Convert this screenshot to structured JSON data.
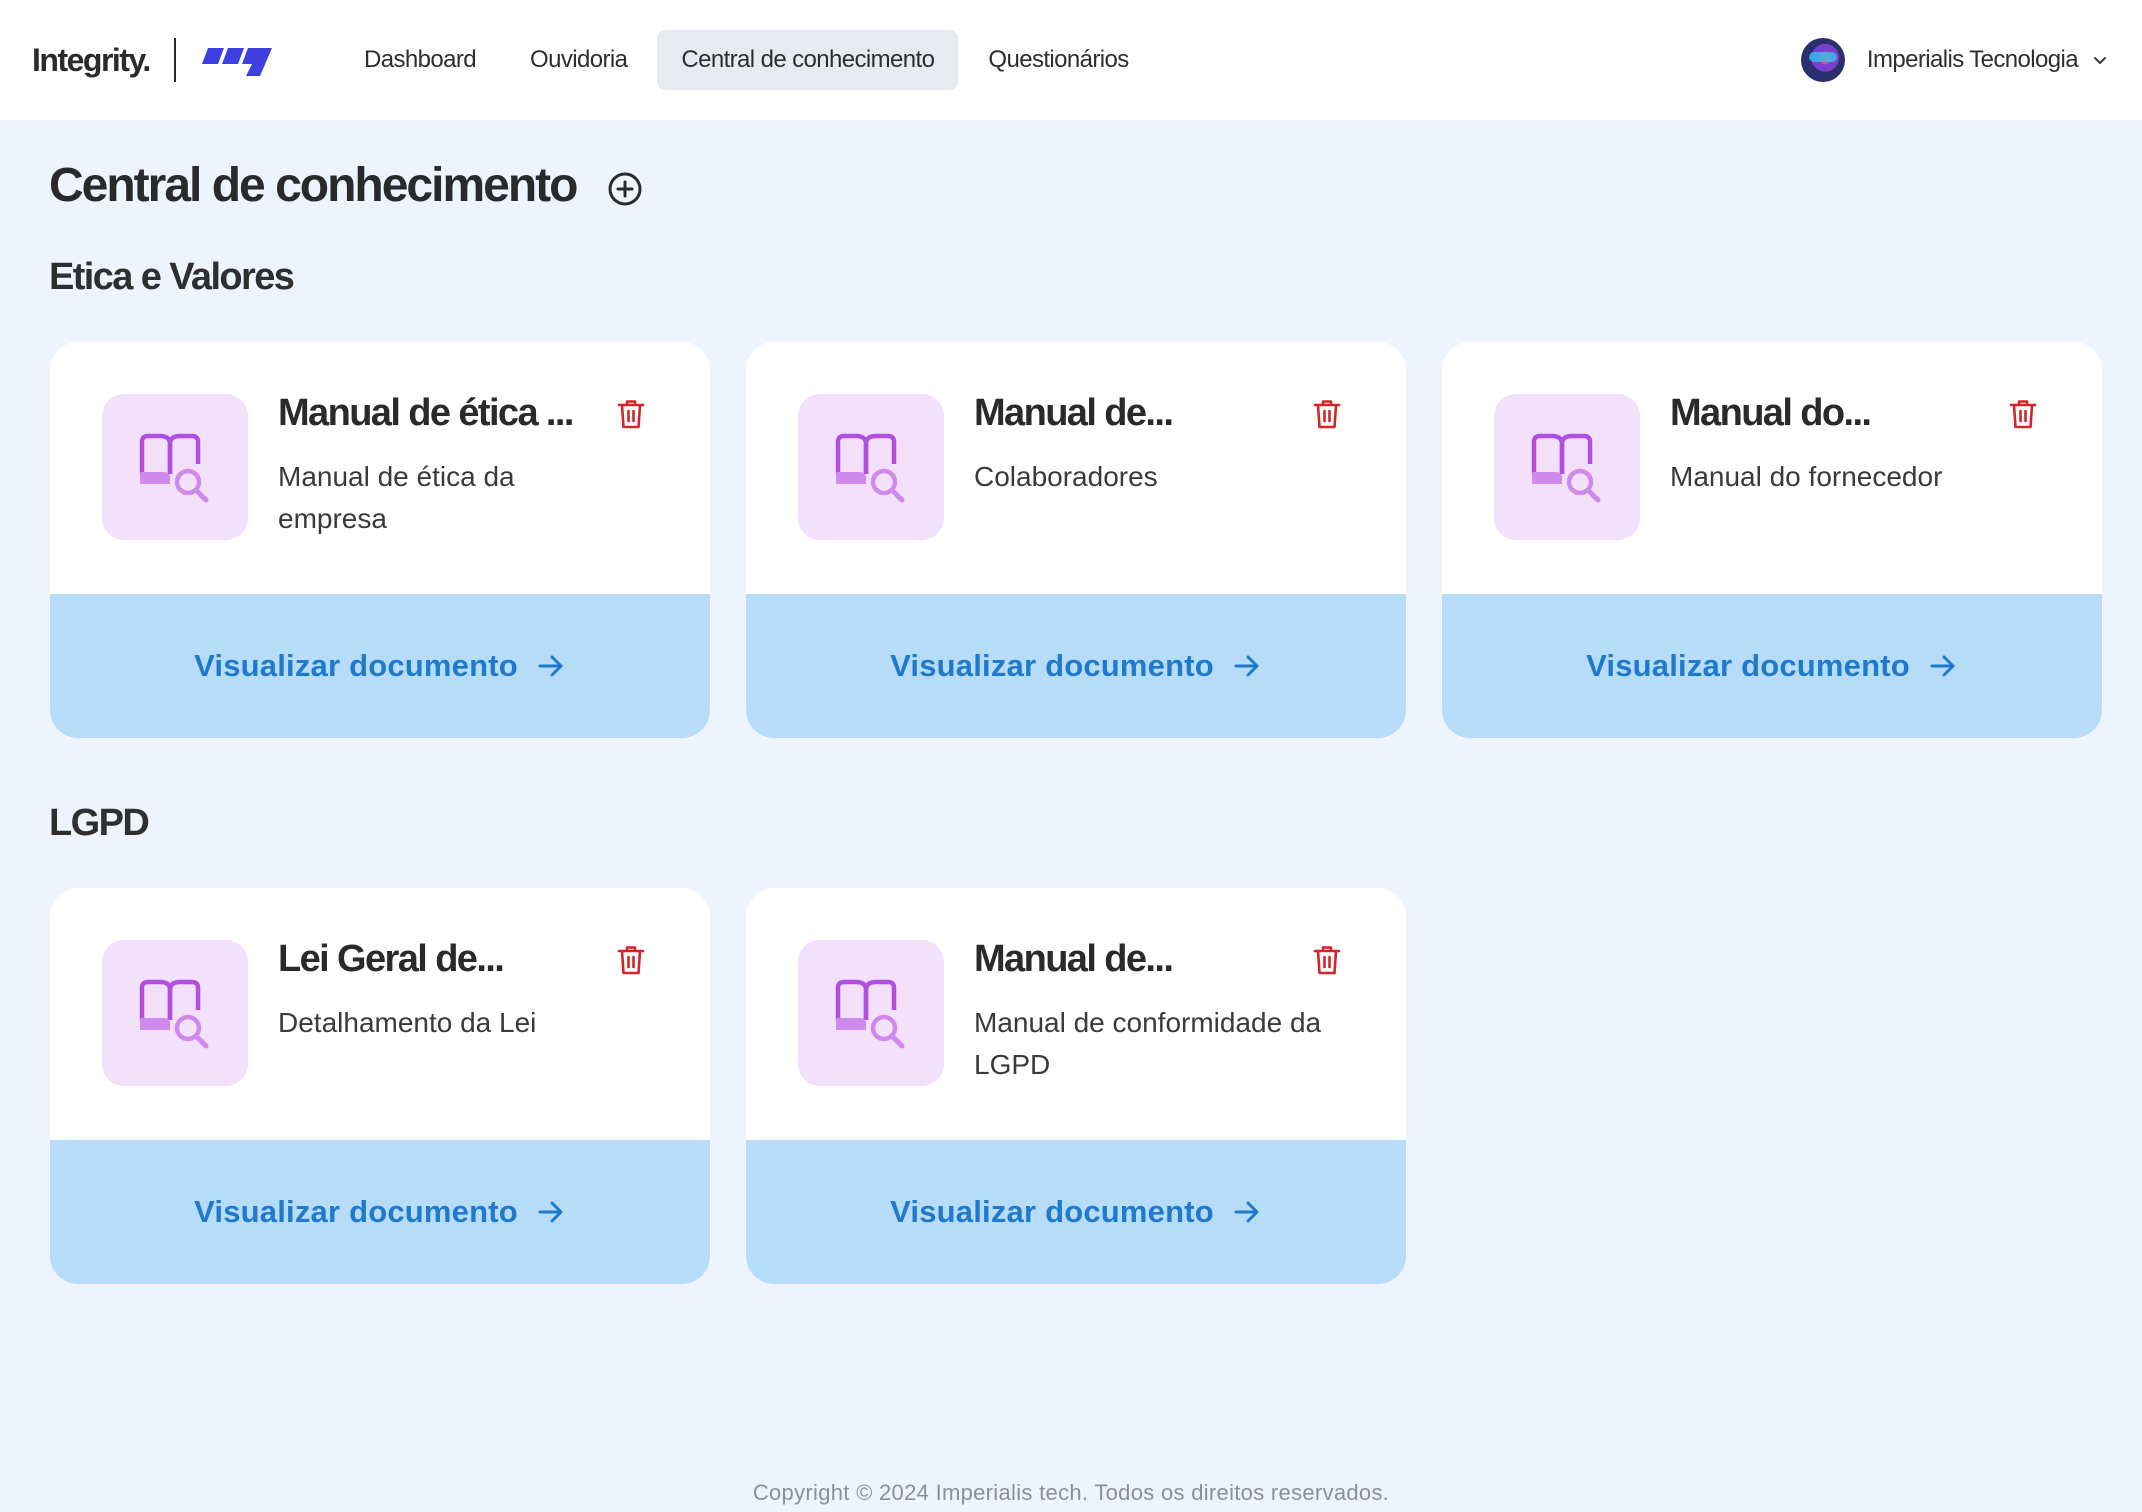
{
  "header": {
    "brand": "Integrity.",
    "nav": [
      {
        "label": "Dashboard",
        "active": false
      },
      {
        "label": "Ouvidoria",
        "active": false
      },
      {
        "label": "Central de conhecimento",
        "active": true
      },
      {
        "label": "Questionários",
        "active": false
      }
    ],
    "user_name": "Imperialis Tecnologia"
  },
  "page": {
    "title": "Central de conhecimento"
  },
  "sections": [
    {
      "title": "Etica e Valores",
      "documents": [
        {
          "title": "Manual de ética ...",
          "description": "Manual de ética da empresa",
          "action": "Visualizar documento"
        },
        {
          "title": "Manual de...",
          "description": "Colaboradores",
          "action": "Visualizar documento"
        },
        {
          "title": "Manual do...",
          "description": "Manual do fornecedor",
          "action": "Visualizar documento"
        }
      ]
    },
    {
      "title": "LGPD",
      "documents": [
        {
          "title": "Lei Geral de...",
          "description": "Detalhamento da Lei",
          "action": "Visualizar documento"
        },
        {
          "title": "Manual de...",
          "description": "Manual de conformidade da LGPD",
          "action": "Visualizar documento"
        }
      ]
    }
  ],
  "footer": {
    "copyright": "Copyright © 2024 Imperialis tech. Todos os direitos reservados."
  },
  "icons": {
    "add": "plus-circle-icon",
    "delete": "trash-icon",
    "document": "book-search-icon",
    "action": "arrow-right-icon",
    "user_menu": "chevron-down-icon"
  },
  "colors": {
    "page_background": "#EDF4FE",
    "card_footer": "#B6DCF8",
    "action_text": "#1F7ACD",
    "icon_tile": "#F3E1FB",
    "icon_stroke": "#B24FE0",
    "delete": "#D3262B",
    "active_tab": "#E7EBF1",
    "brand_mark": "#3E3FE0"
  }
}
